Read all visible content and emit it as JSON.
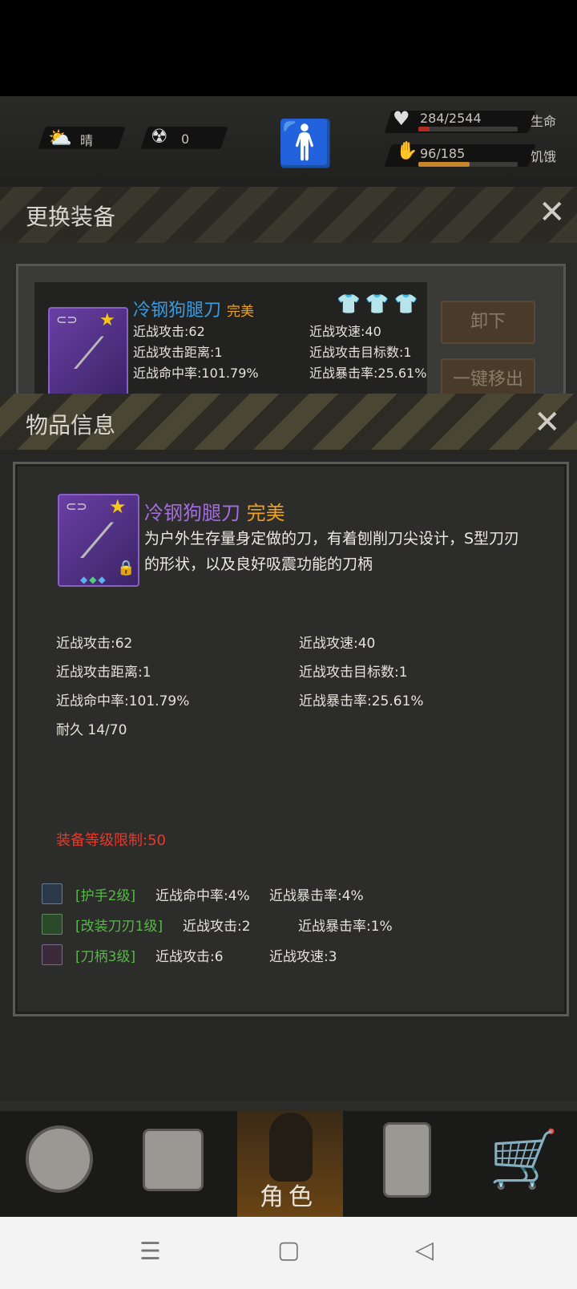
{
  "hud": {
    "weather": "晴",
    "radiation": "0",
    "health_value": "284/2544",
    "health_label": "生命",
    "health_fraction": 0.11,
    "hunger_value": "96/185",
    "hunger_label": "饥饿",
    "hunger_fraction": 0.52
  },
  "equip_panel": {
    "title": "更换装备",
    "item_name": "冷钢狗腿刀",
    "item_quality": "完美",
    "stats_left": [
      "近战攻击:62",
      "近战攻击距离:1",
      "近战命中率:101.79%"
    ],
    "stats_right": [
      "近战攻速:40",
      "近战攻击目标数:1",
      "近战暴击率:25.61%"
    ],
    "unequip_label": "卸下",
    "remove_all_label": "一键移出"
  },
  "item_info": {
    "title": "物品信息",
    "name": "冷钢狗腿刀",
    "quality": "完美",
    "description": "为户外生存量身定做的刀，有着刨削刀尖设计，S型刀刃的形状，以及良好吸震功能的刀柄",
    "stats": [
      {
        "left": "近战攻击:62",
        "right": "近战攻速:40"
      },
      {
        "left": "近战攻击距离:1",
        "right": "近战攻击目标数:1"
      },
      {
        "left": "近战命中率:101.79%",
        "right": "近战暴击率:25.61%"
      },
      {
        "left": "耐久 14/70",
        "right": ""
      }
    ],
    "level_limit": "装备等级限制:50",
    "mods": [
      {
        "name": "[护手2级]",
        "effect1": "近战命中率:4%",
        "effect2": "近战暴击率:4%"
      },
      {
        "name": "[改装刀刃1级]",
        "effect1": "近战攻击:2",
        "effect2": "近战暴击率:1%"
      },
      {
        "name": "[刀柄3级]",
        "effect1": "近战攻击:6",
        "effect2": "近战攻速:3"
      }
    ]
  },
  "nav": {
    "active_label": "角色"
  },
  "colors": {
    "rarity_purple": "#a56be0",
    "quality_orange": "#f0a020",
    "mod_green": "#59b84a",
    "warning_red": "#e53a2c",
    "health_red": "#b02a22",
    "hunger_orange": "#c7862a"
  },
  "icons": [
    "cloud-sun-icon",
    "radiation-icon",
    "person-plus-icon",
    "heart-icon",
    "stomach-icon",
    "close-icon",
    "link-icon",
    "star-icon",
    "lock-icon",
    "shirt-icon",
    "globe-icon",
    "backpack-icon",
    "character-icon",
    "walkie-talkie-icon",
    "cart-icon",
    "menu-icon",
    "home-icon",
    "back-icon"
  ]
}
